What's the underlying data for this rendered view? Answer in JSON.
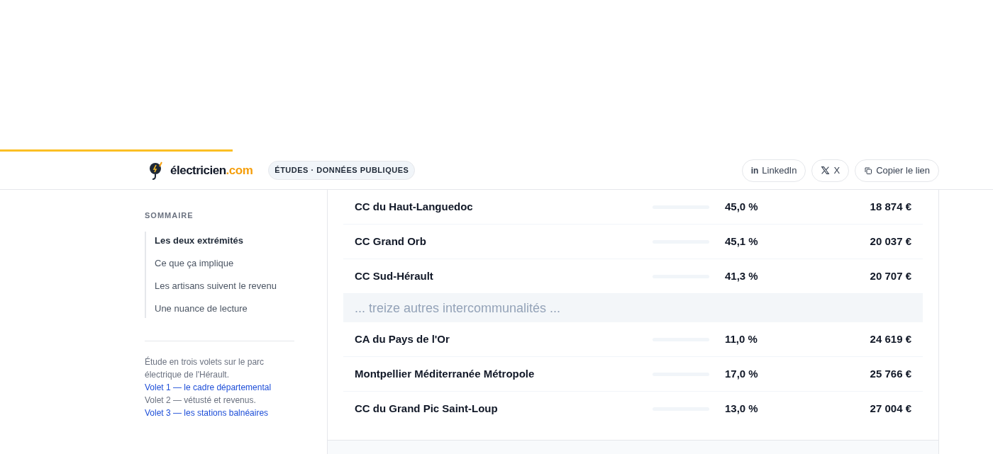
{
  "reading_progress": {
    "level": 0.234
  },
  "header": {
    "logo": {
      "name": "électricien",
      "tld": ".com"
    },
    "badge": "ÉTUDES · DONNÉES PUBLIQUES",
    "share_buttons": [
      {
        "kind": "linkedin",
        "glyph": "in",
        "label": "LinkedIn"
      },
      {
        "kind": "x",
        "label": "X"
      },
      {
        "kind": "copy",
        "label": "Copier le lien"
      }
    ]
  },
  "sidebar": {
    "title": "SOMMAIRE",
    "items": [
      {
        "label": "Les deux extrémités",
        "selected": true
      },
      {
        "label": "Ce que ça implique",
        "selected": false
      },
      {
        "label": "Les artisans suivent le revenu",
        "selected": false
      },
      {
        "label": "Une nuance de lecture",
        "selected": false
      }
    ],
    "intro": "Étude en trois volets sur le parc électrique de l'Hérault.",
    "volets": [
      {
        "kind": "link",
        "text": "Volet 1 — le cadre départemental"
      },
      {
        "kind": "plain",
        "text": "Volet 2 — vétusté et revenus."
      },
      {
        "kind": "link",
        "text": "Volet 3 — les stations balnéaires"
      }
    ]
  },
  "table": {
    "rows": [
      {
        "kind": "data",
        "name": "CC du Haut-Languedoc",
        "share": "45,0 %",
        "income": "18 874 €"
      },
      {
        "kind": "data",
        "name": "CC Grand Orb",
        "share": "45,1 %",
        "income": "20 037 €"
      },
      {
        "kind": "data",
        "name": "CC Sud-Hérault",
        "share": "41,3 %",
        "income": "20 707 €"
      },
      {
        "kind": "gap",
        "text": "... treize autres intercommunalités ..."
      },
      {
        "kind": "data",
        "name": "CA du Pays de l'Or",
        "share": "11,0 %",
        "income": "24 619 €"
      },
      {
        "kind": "data",
        "name": "Montpellier Méditerranée Métropole",
        "share": "17,0 %",
        "income": "25 766 €"
      },
      {
        "kind": "data",
        "name": "CC du Grand Pic Saint-Loup",
        "share": "13,0 %",
        "income": "27 004 €"
      }
    ]
  }
}
